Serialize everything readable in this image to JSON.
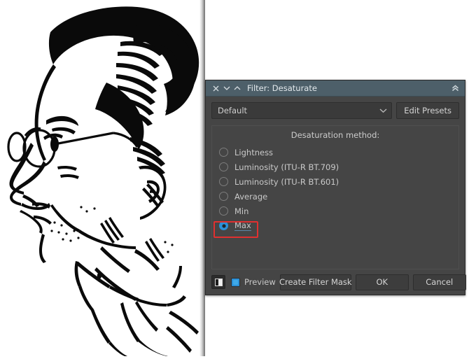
{
  "window": {
    "title": "Filter: Desaturate",
    "titlebar_bg": "#4d5f69",
    "dialog_bg": "#454545",
    "accent": "#2a90d8",
    "highlight_color": "#e03030",
    "close_icon": "close-icon",
    "prev_icon": "chevron-down-icon",
    "next_icon": "chevron-up-icon",
    "collapse_icon": "double-chevron-up-icon"
  },
  "preset": {
    "value": "Default",
    "placeholder": "Default",
    "dropdown_icon": "chevron-down-icon",
    "edit_label": "Edit Presets"
  },
  "method": {
    "title": "Desaturation method:",
    "selected": "Max",
    "options": [
      {
        "label": "Lightness",
        "checked": false
      },
      {
        "label": "Luminosity (ITU-R BT.709)",
        "checked": false
      },
      {
        "label": "Luminosity (ITU-R BT.601)",
        "checked": false
      },
      {
        "label": "Average",
        "checked": false
      },
      {
        "label": "Min",
        "checked": false
      },
      {
        "label": "Max",
        "checked": true
      }
    ]
  },
  "footer": {
    "split_icon": "split-view-icon",
    "preview_label": "Preview",
    "preview_checked": true,
    "create_mask_label": "Create Filter Mask",
    "ok_label": "OK",
    "cancel_label": "Cancel"
  },
  "artwork": {
    "description": "Black and white line-art portrait of a man in profile wearing round glasses and a collared shirt"
  }
}
